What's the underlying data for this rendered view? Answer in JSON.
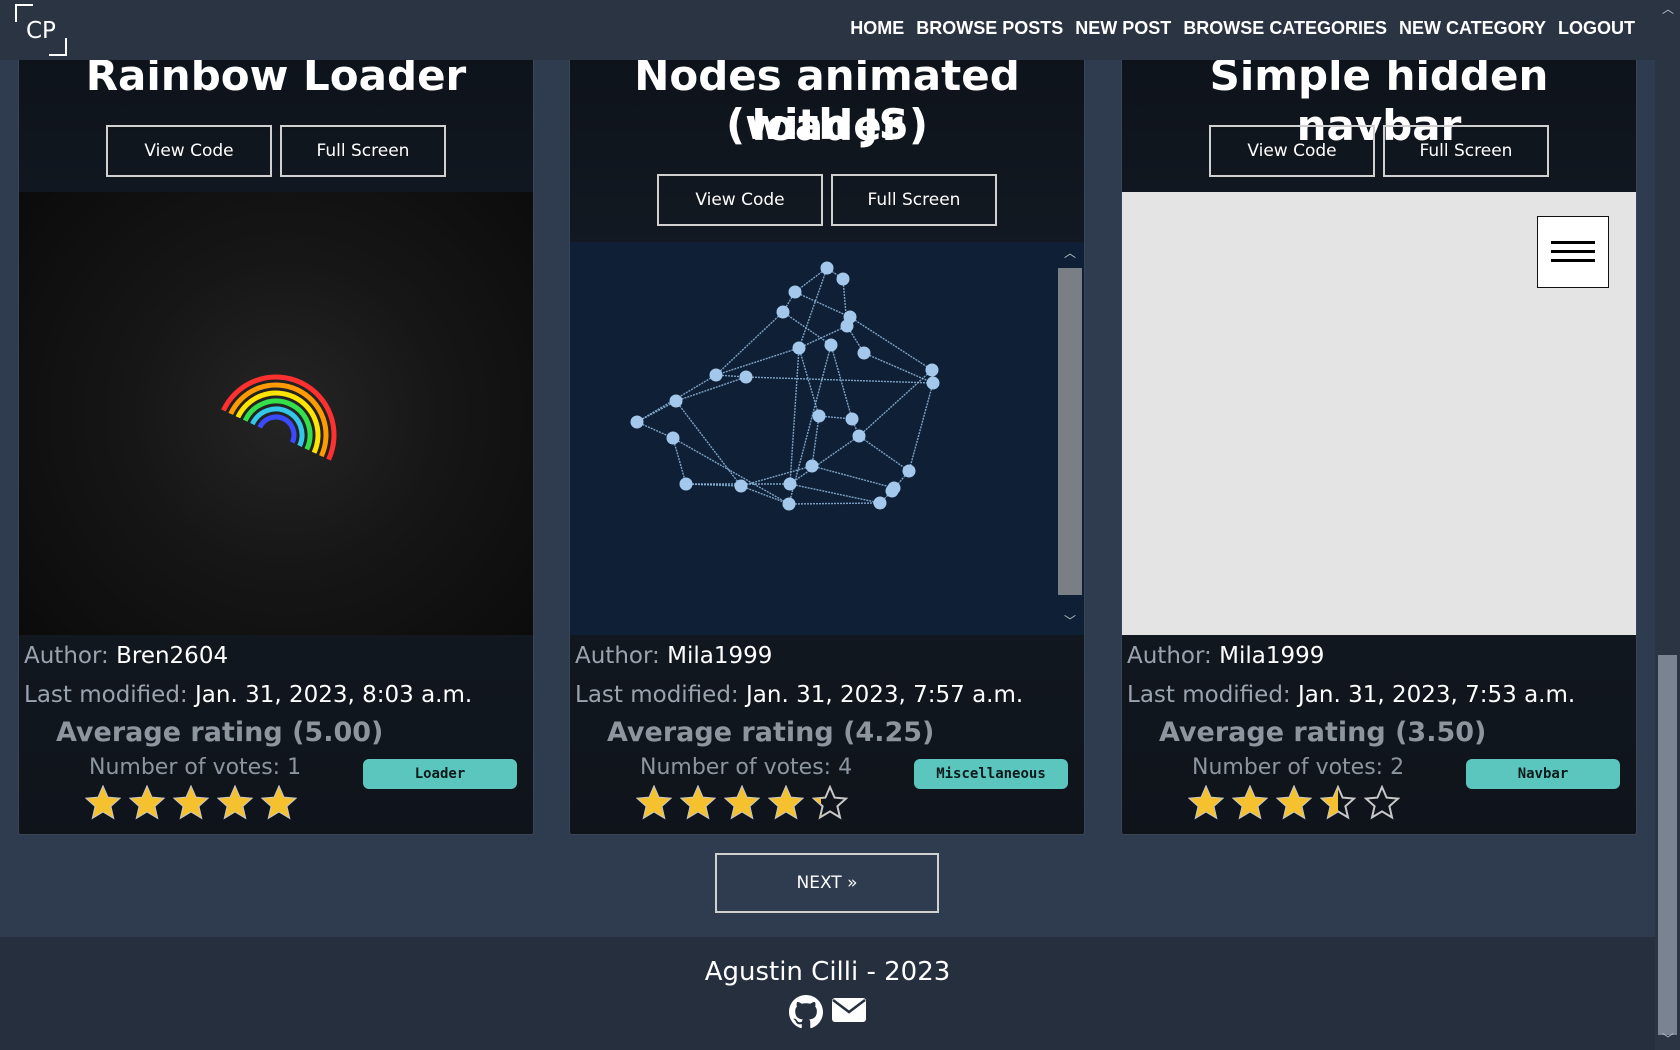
{
  "nav": {
    "logo": "CP",
    "links": [
      "HOME",
      "BROWSE POSTS",
      "NEW POST",
      "BROWSE CATEGORIES",
      "NEW CATEGORY",
      "LOGOUT"
    ]
  },
  "posts": [
    {
      "title": "Rainbow Loader",
      "view_code": "View Code",
      "full_screen": "Full Screen",
      "author_label": "Author:",
      "author": "Bren2604",
      "modified_label": "Last modified:",
      "modified": "Jan. 31, 2023, 8:03 a.m.",
      "avg_rating": "Average rating (5.00)",
      "votes": "Number of votes: 1",
      "category": "Loader",
      "rating": 5
    },
    {
      "title_line1": "Nodes animated loader",
      "title_line2": "(with JS)",
      "view_code": "View Code",
      "full_screen": "Full Screen",
      "author_label": "Author:",
      "author": "Mila1999",
      "modified_label": "Last modified:",
      "modified": "Jan. 31, 2023, 7:57 a.m.",
      "avg_rating": "Average rating (4.25)",
      "votes": "Number of votes: 4",
      "category": "Miscellaneous",
      "rating": 4.25
    },
    {
      "title": "Simple hidden navbar",
      "view_code": "View Code",
      "full_screen": "Full Screen",
      "author_label": "Author:",
      "author": "Mila1999",
      "modified_label": "Last modified:",
      "modified": "Jan. 31, 2023, 7:53 a.m.",
      "avg_rating": "Average rating (3.50)",
      "votes": "Number of votes: 2",
      "category": "Navbar",
      "rating": 3.5
    }
  ],
  "pagination": {
    "next": "NEXT »"
  },
  "footer": {
    "text": "Agustin Cilli - 2023",
    "icons": [
      "github-icon",
      "envelope-icon"
    ]
  },
  "colors": {
    "background": "#2f3b4e",
    "badge": "#5bc6be",
    "star": "#f5c12e"
  }
}
